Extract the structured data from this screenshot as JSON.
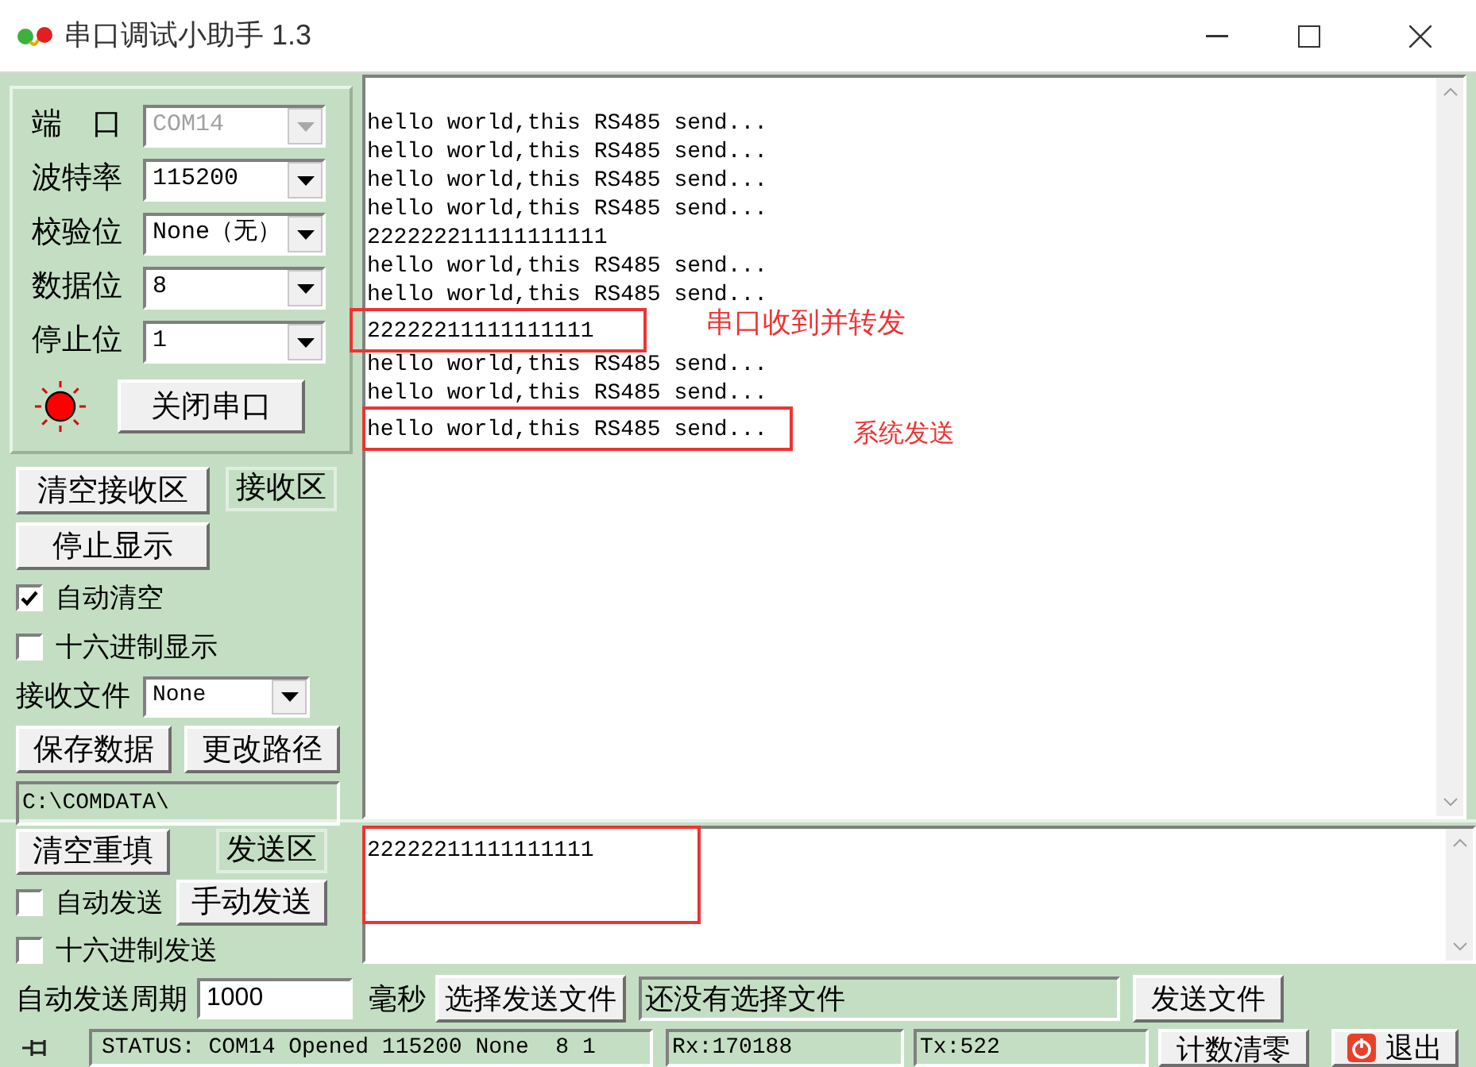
{
  "window": {
    "title": "串口调试小助手 1.3"
  },
  "port_settings": [
    {
      "label": "端　口",
      "value": "COM14",
      "disabled": true
    },
    {
      "label": "波特率",
      "value": "115200",
      "disabled": false
    },
    {
      "label": "校验位",
      "value": "None（无）",
      "disabled": false
    },
    {
      "label": "数据位",
      "value": "8",
      "disabled": false
    },
    {
      "label": "停止位",
      "value": "1",
      "disabled": false
    }
  ],
  "port_led": {
    "on": true
  },
  "open_close_button": "关闭串口",
  "receive_controls": {
    "clear_button": "清空接收区",
    "area_label": "接收区",
    "stop_button": "停止显示",
    "options": [
      {
        "label": "自动清空",
        "checked": true
      },
      {
        "label": "十六进制显示",
        "checked": false
      }
    ],
    "file_label": "接收文件",
    "file_value": "None",
    "save_button": "保存数据",
    "path_button": "更改路径",
    "path": "C:\\COMDATA\\"
  },
  "receive_lines": [
    {
      "text": "hello world,this RS485 send...",
      "framed": false
    },
    {
      "text": "hello world,this RS485 send...",
      "framed": false
    },
    {
      "text": "hello world,this RS485 send...",
      "framed": false
    },
    {
      "text": "hello world,this RS485 send...",
      "framed": false
    },
    {
      "text": "222222211111111111",
      "framed": false
    },
    {
      "text": "hello world,this RS485 send...",
      "framed": false
    },
    {
      "text": "hello world,this RS485 send...",
      "framed": false
    },
    {
      "text": "22222211111111111",
      "framed": true
    },
    {
      "text": "hello world,this RS485 send...",
      "framed": false
    },
    {
      "text": "hello world,this RS485 send...",
      "framed": false
    },
    {
      "text": "hello world,this RS485 send...",
      "framed": true
    }
  ],
  "annotations": [
    "串口收到并转发",
    "系统发送"
  ],
  "send_controls": {
    "clear_button": "清空重填",
    "area_label": "发送区",
    "auto_send": {
      "label": "自动发送",
      "checked": false
    },
    "manual_button": "手动发送",
    "hex_send": {
      "label": "十六进制发送",
      "checked": false
    }
  },
  "send_text": "22222211111111111",
  "send_file_row": {
    "period_label": "自动发送周期",
    "period_value": "1000",
    "unit": "毫秒",
    "choose_button": "选择发送文件",
    "file_status": "还没有选择文件",
    "send_file_button": "发送文件"
  },
  "status_bar": {
    "status": "STATUS: COM14 Opened 115200 None  8 1",
    "rx": "Rx:170188",
    "tx": "Tx:522",
    "reset_button": "计数清零",
    "exit_button": "退出"
  }
}
